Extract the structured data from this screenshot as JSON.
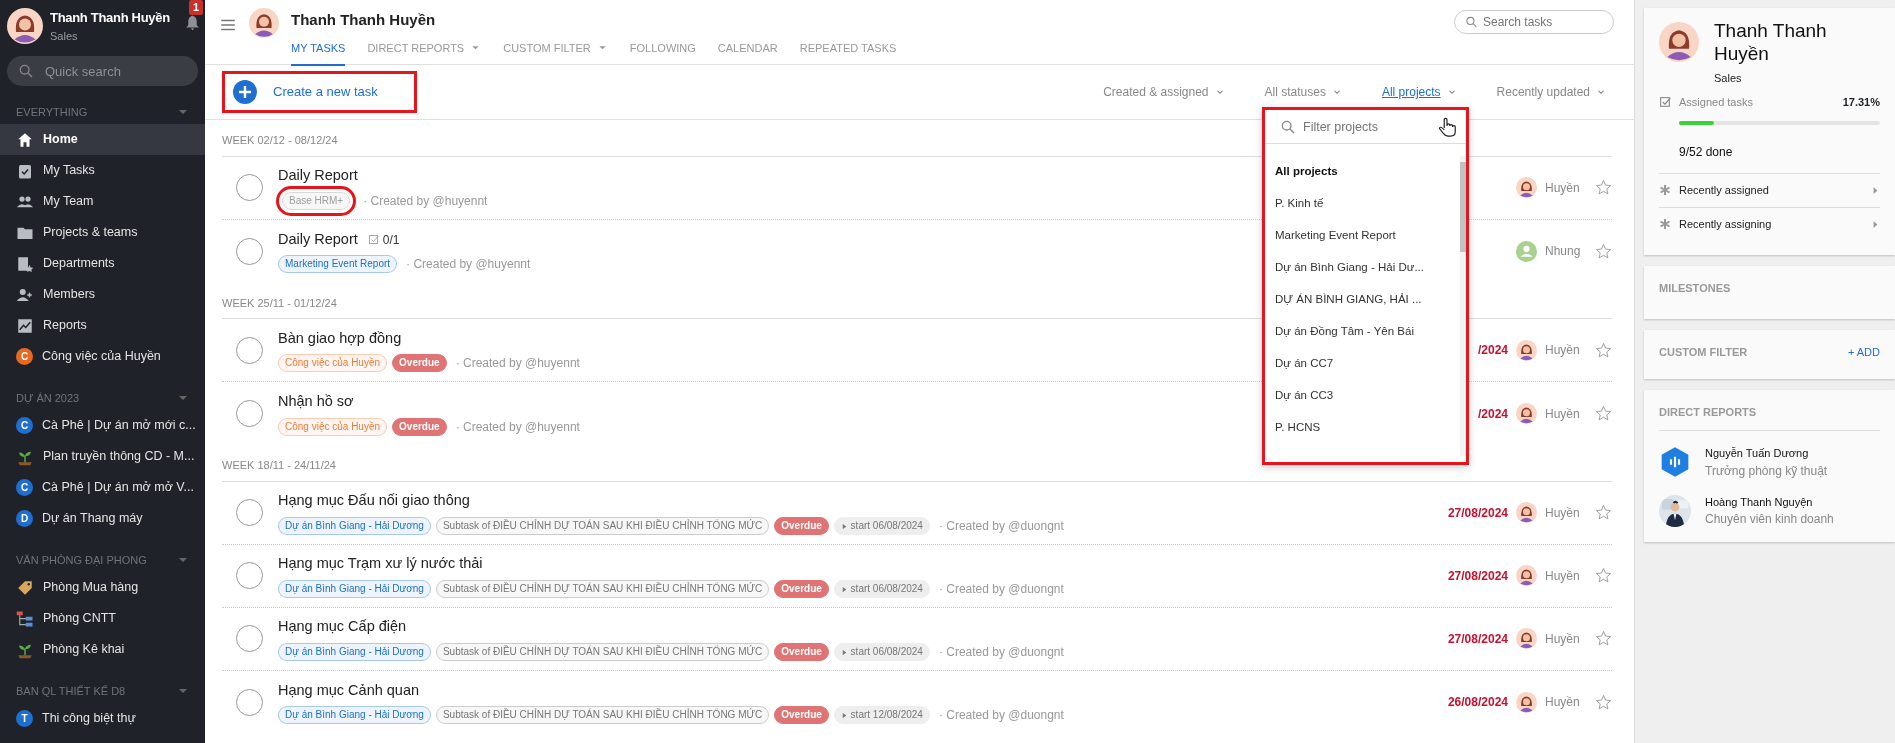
{
  "sidebar": {
    "user": {
      "name": "Thanh Thanh Huyền",
      "role": "Sales",
      "notifications": "1"
    },
    "search": {
      "placeholder": "Quick search"
    },
    "sections": [
      {
        "title": "EVERYTHING",
        "items": [
          {
            "label": "Home",
            "kind": "home",
            "selected": true
          },
          {
            "label": "My Tasks",
            "kind": "tasks",
            "selected": false
          },
          {
            "label": "My Team",
            "kind": "team",
            "selected": false
          },
          {
            "label": "Projects & teams",
            "kind": "folder",
            "selected": false
          },
          {
            "label": "Departments",
            "kind": "departments",
            "selected": false
          },
          {
            "label": "Members",
            "kind": "members",
            "selected": false
          },
          {
            "label": "Reports",
            "kind": "reports",
            "selected": false
          },
          {
            "label": "Công việc của Huyền",
            "kind": "letter",
            "letter": "C",
            "color": "#e8681f",
            "selected": false
          }
        ]
      },
      {
        "title": "DỰ ÁN 2023",
        "items": [
          {
            "label": "Cà Phê | Dự án mở mới c...",
            "kind": "letter",
            "letter": "C",
            "color": "#1e6fd0",
            "selected": false
          },
          {
            "label": "Plan truyền thông CD - M...",
            "kind": "plant",
            "selected": false
          },
          {
            "label": "Cà Phê | Dự án mở mở V...",
            "kind": "letter",
            "letter": "C",
            "color": "#1e6fd0",
            "selected": false
          },
          {
            "label": "Dự án Thang máy",
            "kind": "letter",
            "letter": "D",
            "color": "#1e6fd0",
            "selected": false
          }
        ]
      },
      {
        "title": "VĂN PHÒNG ĐẠI PHONG",
        "items": [
          {
            "label": "Phòng Mua hàng",
            "kind": "tag",
            "selected": false
          },
          {
            "label": "Phòng CNTT",
            "kind": "org",
            "selected": false
          },
          {
            "label": "Phòng Kê khai",
            "kind": "plant",
            "selected": false
          }
        ]
      },
      {
        "title": "BAN QL THIẾT KẾ D8",
        "items": [
          {
            "label": "Thi công biệt thự",
            "kind": "letter",
            "letter": "T",
            "color": "#1e6fd0",
            "selected": false
          }
        ]
      }
    ]
  },
  "header": {
    "title": "Thanh Thanh Huyền",
    "search": {
      "placeholder": "Search tasks"
    },
    "tabs": [
      {
        "label": "MY TASKS",
        "selected": true,
        "has_menu": false
      },
      {
        "label": "DIRECT REPORTS",
        "selected": false,
        "has_menu": true
      },
      {
        "label": "CUSTOM FILTER",
        "selected": false,
        "has_menu": true
      },
      {
        "label": "FOLLOWING",
        "selected": false,
        "has_menu": false
      },
      {
        "label": "CALENDAR",
        "selected": false,
        "has_menu": false
      },
      {
        "label": "REPEATED TASKS",
        "selected": false,
        "has_menu": false
      }
    ]
  },
  "toolbar": {
    "create": {
      "label": "Create a new task",
      "highlighted": true
    },
    "filters": [
      {
        "label": "Created & assigned",
        "selected": false
      },
      {
        "label": "All statuses",
        "selected": false
      },
      {
        "label": "All projects",
        "selected": true
      },
      {
        "label": "Recently updated",
        "selected": false
      }
    ]
  },
  "project_dropdown": {
    "highlighted": true,
    "search": {
      "placeholder": "Filter projects"
    },
    "items": [
      {
        "label": "All projects",
        "selected": true
      },
      {
        "label": "P. Kinh tế",
        "selected": false
      },
      {
        "label": "Marketing Event Report",
        "selected": false
      },
      {
        "label": "Dự án Bình Giang - Hải Dư...",
        "selected": false
      },
      {
        "label": "DỰ ÁN BÌNH GIANG, HẢI ...",
        "selected": false
      },
      {
        "label": "Dự án Đồng Tâm - Yên Bái",
        "selected": false
      },
      {
        "label": "Dự án CC7",
        "selected": false
      },
      {
        "label": "Dự án CC3",
        "selected": false
      },
      {
        "label": "P. HCNS",
        "selected": false
      }
    ]
  },
  "groups": [
    {
      "title": "WEEK 02/12 - 08/12/24",
      "tasks": [
        {
          "title": "Daily Report",
          "done": false,
          "tags": [
            {
              "kind": "project",
              "label": "Base HRM+",
              "color": "#9e9e9e",
              "highlighted": true
            }
          ],
          "created_by": "· Created by @huyennt",
          "assignee": {
            "name": "Huyền",
            "kind": "person"
          },
          "starred": false
        },
        {
          "title": "Daily Report",
          "done": false,
          "checklist": "0/1",
          "tags": [
            {
              "kind": "project",
              "label": "Marketing Event Report",
              "color": "#1e6fd0",
              "highlighted": false
            }
          ],
          "created_by": "· Created by @huyennt",
          "assignee": {
            "name": "Nhung",
            "kind": "generic"
          },
          "starred": false
        }
      ]
    },
    {
      "title": "WEEK 25/11 - 01/12/24",
      "tasks": [
        {
          "title": "Bàn giao hợp đồng",
          "done": false,
          "tags": [
            {
              "kind": "project",
              "label": "Công việc của Huyền",
              "color": "#f07b3a",
              "highlighted": false
            },
            {
              "kind": "overdue",
              "label": "Overdue"
            }
          ],
          "created_by": "· Created by @huyennt",
          "due": "/2024",
          "assignee": {
            "name": "Huyền",
            "kind": "person"
          },
          "starred": false
        },
        {
          "title": "Nhận hồ sơ",
          "done": false,
          "tags": [
            {
              "kind": "project",
              "label": "Công việc của Huyền",
              "color": "#f07b3a",
              "highlighted": false
            },
            {
              "kind": "overdue",
              "label": "Overdue"
            }
          ],
          "created_by": "· Created by @huyennt",
          "due": "/2024",
          "assignee": {
            "name": "Huyền",
            "kind": "person"
          },
          "starred": false
        }
      ]
    },
    {
      "title": "WEEK 18/11 - 24/11/24",
      "tasks": [
        {
          "title": "Hạng mục Đấu nối giao thông",
          "done": false,
          "tags": [
            {
              "kind": "project",
              "label": "Dự án Bình Giang - Hải Dương",
              "color": "#1e6fd0",
              "highlighted": false
            },
            {
              "kind": "subtask",
              "label": "Subtask of ĐIỀU CHỈNH DỰ TOÁN SAU KHI ĐIỀU CHỈNH TỔNG MỨC"
            },
            {
              "kind": "overdue",
              "label": "Overdue"
            },
            {
              "kind": "start",
              "label": "start 06/08/2024"
            }
          ],
          "created_by": "· Created by @duongnt",
          "due": "27/08/2024",
          "assignee": {
            "name": "Huyền",
            "kind": "person"
          },
          "starred": false
        },
        {
          "title": "Hạng mục Trạm xư lý nước thải",
          "done": false,
          "tags": [
            {
              "kind": "project",
              "label": "Dự án Bình Giang - Hải Dương",
              "color": "#1e6fd0",
              "highlighted": false
            },
            {
              "kind": "subtask",
              "label": "Subtask of ĐIỀU CHỈNH DỰ TOÁN SAU KHI ĐIỀU CHỈNH TỔNG MỨC"
            },
            {
              "kind": "overdue",
              "label": "Overdue"
            },
            {
              "kind": "start",
              "label": "start 06/08/2024"
            }
          ],
          "created_by": "· Created by @duongnt",
          "due": "27/08/2024",
          "assignee": {
            "name": "Huyền",
            "kind": "person"
          },
          "starred": false
        },
        {
          "title": "Hạng mục Cấp điện",
          "done": false,
          "tags": [
            {
              "kind": "project",
              "label": "Dự án Bình Giang - Hải Dương",
              "color": "#1e6fd0",
              "highlighted": false
            },
            {
              "kind": "subtask",
              "label": "Subtask of ĐIỀU CHỈNH DỰ TOÁN SAU KHI ĐIỀU CHỈNH TỔNG MỨC"
            },
            {
              "kind": "overdue",
              "label": "Overdue"
            },
            {
              "kind": "start",
              "label": "start 06/08/2024"
            }
          ],
          "created_by": "· Created by @duongnt",
          "due": "27/08/2024",
          "assignee": {
            "name": "Huyền",
            "kind": "person"
          },
          "starred": false
        },
        {
          "title": "Hạng mục Cảnh quan",
          "done": false,
          "tags": [
            {
              "kind": "project",
              "label": "Dự án Bình Giang - Hải Dương",
              "color": "#1e6fd0",
              "highlighted": false
            },
            {
              "kind": "subtask",
              "label": "Subtask of ĐIỀU CHỈNH DỰ TOÁN SAU KHI ĐIỀU CHỈNH TỔNG MỨC"
            },
            {
              "kind": "overdue",
              "label": "Overdue"
            },
            {
              "kind": "start",
              "label": "start 12/08/2024"
            }
          ],
          "created_by": "· Created by @duongnt",
          "due": "26/08/2024",
          "assignee": {
            "name": "Huyền",
            "kind": "person"
          },
          "starred": false
        }
      ]
    }
  ],
  "profile": {
    "name": "Thanh Thanh Huyền",
    "role": "Sales",
    "stat_label": "Assigned tasks",
    "percent": "17.31%",
    "level": 0.1731,
    "done": "9/52 done",
    "links": [
      {
        "label": "Recently assigned"
      },
      {
        "label": "Recently assigning"
      }
    ]
  },
  "milestones": {
    "title": "MILESTONES"
  },
  "custom_filter": {
    "title": "CUSTOM FILTER",
    "add": "+ ADD"
  },
  "direct_reports": {
    "title": "DIRECT REPORTS",
    "people": [
      {
        "name": "Nguyễn Tuấn Dương",
        "job": "Trưởng phòng kỹ thuật",
        "kind": "logo"
      },
      {
        "name": "Hoàng Thanh Nguyện",
        "job": "Chuyên viên kinh doanh"
      }
    ]
  }
}
